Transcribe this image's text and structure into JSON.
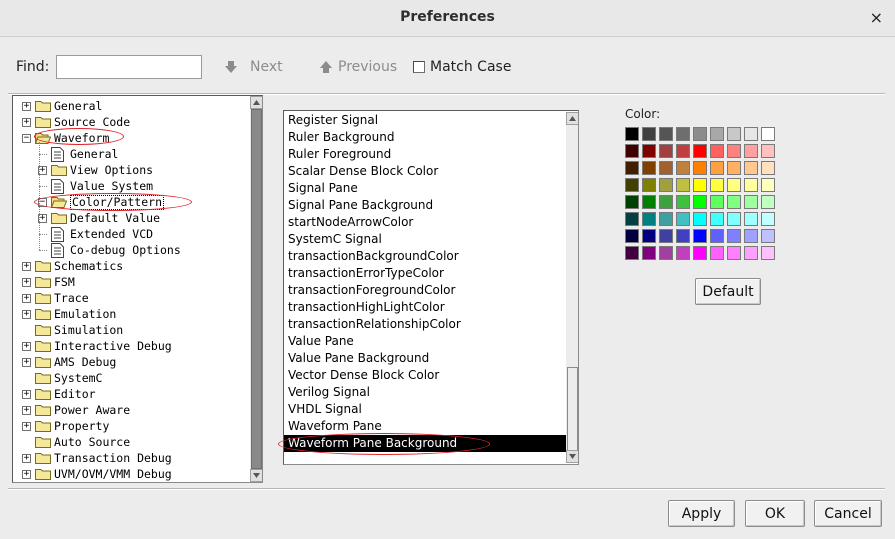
{
  "window": {
    "title": "Preferences",
    "close_glyph": "×"
  },
  "find": {
    "label": "Find:",
    "value": "",
    "placeholder": "",
    "next_label": "Next",
    "previous_label": "Previous",
    "match_case_label": "Match Case",
    "match_case_checked": false
  },
  "tree": {
    "items": [
      {
        "label": "General",
        "level": 0,
        "icon": "folder-icon",
        "expander": "+"
      },
      {
        "label": "Source Code",
        "level": 0,
        "icon": "folder-icon",
        "expander": "+"
      },
      {
        "label": "Waveform",
        "level": 0,
        "icon": "open-folder-icon",
        "expander": "-"
      },
      {
        "label": "General",
        "level": 1,
        "icon": "page-icon",
        "expander": ""
      },
      {
        "label": "View Options",
        "level": 1,
        "icon": "folder-icon",
        "expander": "+"
      },
      {
        "label": "Value System",
        "level": 1,
        "icon": "page-icon",
        "expander": ""
      },
      {
        "label": "Color/Pattern",
        "level": 1,
        "icon": "open-folder-icon",
        "expander": "-",
        "selected": true
      },
      {
        "label": "Default Value",
        "level": 1,
        "icon": "folder-icon",
        "expander": "+"
      },
      {
        "label": "Extended VCD",
        "level": 1,
        "icon": "page-icon",
        "expander": ""
      },
      {
        "label": "Co-debug Options",
        "level": 1,
        "icon": "page-icon",
        "expander": ""
      },
      {
        "label": "Schematics",
        "level": 0,
        "icon": "folder-icon",
        "expander": "+"
      },
      {
        "label": "FSM",
        "level": 0,
        "icon": "folder-icon",
        "expander": "+"
      },
      {
        "label": "Trace",
        "level": 0,
        "icon": "folder-icon",
        "expander": "+"
      },
      {
        "label": "Emulation",
        "level": 0,
        "icon": "folder-icon",
        "expander": "+"
      },
      {
        "label": "Simulation",
        "level": 0,
        "icon": "folder-icon",
        "expander": ""
      },
      {
        "label": "Interactive Debug",
        "level": 0,
        "icon": "folder-icon",
        "expander": "+"
      },
      {
        "label": "AMS Debug",
        "level": 0,
        "icon": "folder-icon",
        "expander": "+"
      },
      {
        "label": "SystemC",
        "level": 0,
        "icon": "folder-icon",
        "expander": ""
      },
      {
        "label": "Editor",
        "level": 0,
        "icon": "folder-icon",
        "expander": "+"
      },
      {
        "label": "Power Aware",
        "level": 0,
        "icon": "folder-icon",
        "expander": "+"
      },
      {
        "label": "Property",
        "level": 0,
        "icon": "folder-icon",
        "expander": "+"
      },
      {
        "label": "Auto Source",
        "level": 0,
        "icon": "folder-icon",
        "expander": ""
      },
      {
        "label": "Transaction Debug",
        "level": 0,
        "icon": "folder-icon",
        "expander": "+"
      },
      {
        "label": "UVM/OVM/VMM Debug",
        "level": 0,
        "icon": "folder-icon",
        "expander": "+"
      }
    ]
  },
  "color_list": {
    "items": [
      "Register Signal",
      "Ruler Background",
      "Ruler Foreground",
      "Scalar Dense Block Color",
      "Signal Pane",
      "Signal Pane Background",
      "startNodeArrowColor",
      "SystemC Signal",
      "transactionBackgroundColor",
      "transactionErrorTypeColor",
      "transactionForegroundColor",
      "transactionHighLightColor",
      "transactionRelationshipColor",
      "Value Pane",
      "Value Pane Background",
      "Vector Dense Block Color",
      "Verilog Signal",
      "VHDL Signal",
      "Waveform Pane",
      "Waveform Pane Background"
    ],
    "selected": "Waveform Pane Background"
  },
  "color": {
    "label": "Color:",
    "palette": [
      [
        "#000000",
        "#404040",
        "#555555",
        "#6e6e6e",
        "#8c8c8c",
        "#a8a8a8",
        "#c8c8c8",
        "#e6e6e6",
        "#ffffff"
      ],
      [
        "#400000",
        "#800000",
        "#a04040",
        "#c04040",
        "#ff0000",
        "#ff6060",
        "#ff8080",
        "#ffa0a0",
        "#ffc0c0"
      ],
      [
        "#402000",
        "#804000",
        "#a06030",
        "#c08040",
        "#ff8000",
        "#ffa040",
        "#ffb060",
        "#ffc890",
        "#ffe0c0"
      ],
      [
        "#404000",
        "#808000",
        "#a0a040",
        "#c0c040",
        "#ffff00",
        "#ffff40",
        "#ffff80",
        "#ffffa0",
        "#ffffc0"
      ],
      [
        "#004000",
        "#008000",
        "#40a040",
        "#40c040",
        "#00ff00",
        "#60ff60",
        "#80ff80",
        "#a0ffa0",
        "#c0ffc0"
      ],
      [
        "#004040",
        "#008080",
        "#40a0a0",
        "#40c0c0",
        "#00ffff",
        "#40ffff",
        "#80ffff",
        "#a0ffff",
        "#c0ffff"
      ],
      [
        "#000040",
        "#000080",
        "#4040a0",
        "#4040c0",
        "#0000ff",
        "#6060ff",
        "#8080ff",
        "#a0a0ff",
        "#c0c0ff"
      ],
      [
        "#400040",
        "#800080",
        "#a040a0",
        "#c040c0",
        "#ff00ff",
        "#ff60ff",
        "#ff80ff",
        "#ffa0ff",
        "#ffc0ff"
      ]
    ],
    "default_label": "Default"
  },
  "footer": {
    "apply_label": "Apply",
    "ok_label": "OK",
    "cancel_label": "Cancel"
  },
  "annotation_color": "#e0242c"
}
